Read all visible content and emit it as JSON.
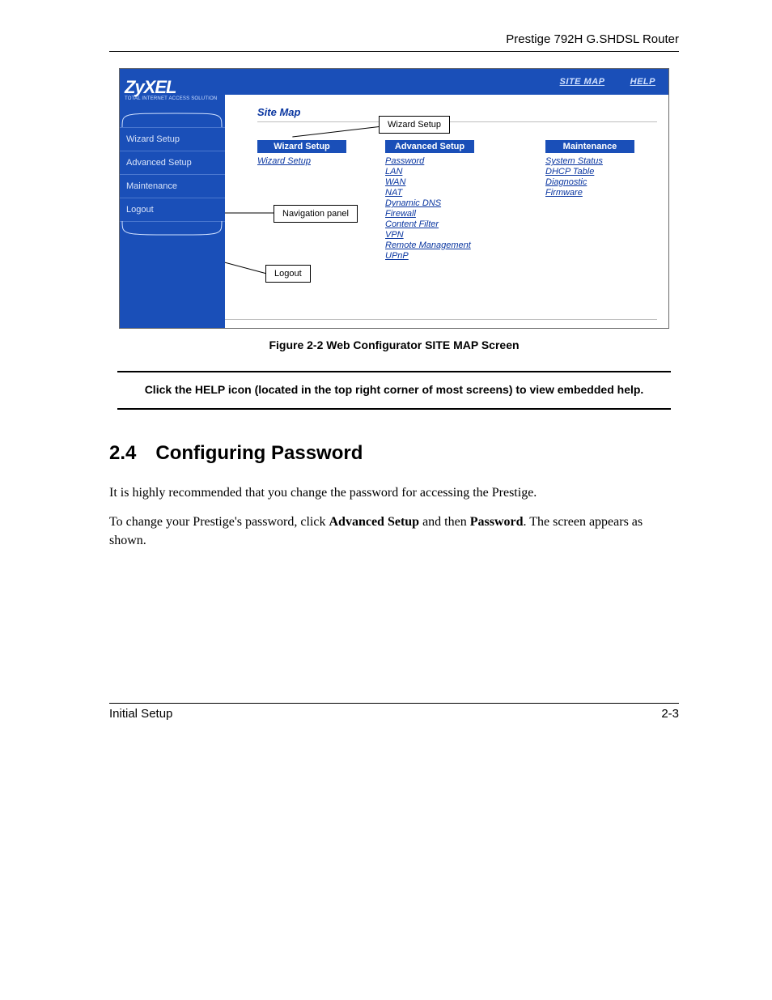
{
  "header": {
    "product": "Prestige 792H G.SHDSL Router"
  },
  "figure": {
    "caption": "Figure 2-2 Web Configurator SITE MAP Screen",
    "callouts": {
      "wizard": "Wizard Setup",
      "navpanel": "Navigation panel",
      "logout": "Logout"
    },
    "logo": {
      "brand": "ZyXEL",
      "tagline": "Total Internet Access Solution"
    },
    "top_links": {
      "sitemap": "SITE MAP",
      "help": "HELP"
    },
    "heading": "Site Map",
    "sidebar": [
      "Wizard Setup",
      "Advanced Setup",
      "Maintenance",
      "Logout"
    ],
    "columns": [
      {
        "title": "Wizard Setup",
        "items": [
          "Wizard Setup"
        ]
      },
      {
        "title": "Advanced Setup",
        "items": [
          "Password",
          "LAN",
          "WAN",
          "NAT",
          "Dynamic DNS",
          "Firewall",
          "Content Filter",
          "VPN",
          "Remote Management",
          "UPnP"
        ]
      },
      {
        "title": "Maintenance",
        "items": [
          "System Status",
          "DHCP Table",
          "Diagnostic",
          "Firmware"
        ]
      }
    ]
  },
  "note": "Click the HELP icon (located in the top right corner of most screens) to view embedded help.",
  "section": {
    "num": "2.4",
    "title": "Configuring Password",
    "p1": "It is highly recommended that you change the password for accessing the Prestige.",
    "p2a": "To change your Prestige's password, click ",
    "p2b": "Advanced Setup",
    "p2c": " and then ",
    "p2d": "Password",
    "p2e": ". The screen appears as shown."
  },
  "footer": {
    "left": "Initial Setup",
    "right": "2-3"
  }
}
